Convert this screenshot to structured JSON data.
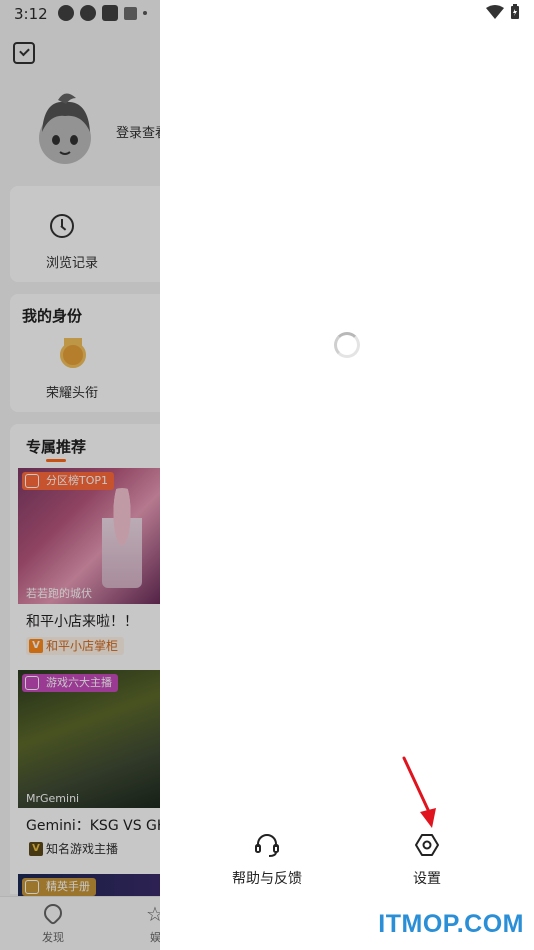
{
  "status_bar": {
    "time": "3:12",
    "left_icons": [
      "pinwheel-icon",
      "pinwheel-icon",
      "square-icon",
      "a-icon",
      "dot-icon"
    ],
    "right_icons": [
      "wifi-icon",
      "battery-icon"
    ]
  },
  "background_app": {
    "login_text": "登录查看",
    "history": {
      "label": "浏览记录",
      "icon": "clock-icon"
    },
    "identity": {
      "title": "我的身份",
      "label": "荣耀头衔",
      "icon": "medal-icon"
    },
    "recommend": {
      "title": "专属推荐",
      "items": [
        {
          "tag": "分区榜TOP1",
          "caption": "若若跑的城伏",
          "title": "和平小店来啦！！",
          "author": "和平小店掌柜",
          "badge": "V"
        },
        {
          "tag": "游戏六大主播",
          "caption": "MrGemini",
          "title": "Gemini：KSG VS GK",
          "author": "知名游戏主播",
          "badge": "V"
        },
        {
          "tag": "精英手册"
        }
      ]
    },
    "bottom_nav": [
      {
        "label": "发现",
        "icon": "discover-icon"
      },
      {
        "label": "娱",
        "icon": "star-icon"
      }
    ]
  },
  "drawer": {
    "loading_icon": "spinner-icon",
    "help": {
      "label": "帮助与反馈",
      "icon": "headset-icon"
    },
    "settings": {
      "label": "设置",
      "icon": "hexagon-gear-icon"
    }
  },
  "annotation": {
    "arrow_color": "#e0141e"
  },
  "watermark": {
    "text": "ITMOP.COM",
    "color": "#2a8fd6"
  },
  "colors": {
    "accent": "#ff6a1a",
    "tag_orange": "#ff6a3c",
    "tag_purple": "#c64bbd"
  }
}
